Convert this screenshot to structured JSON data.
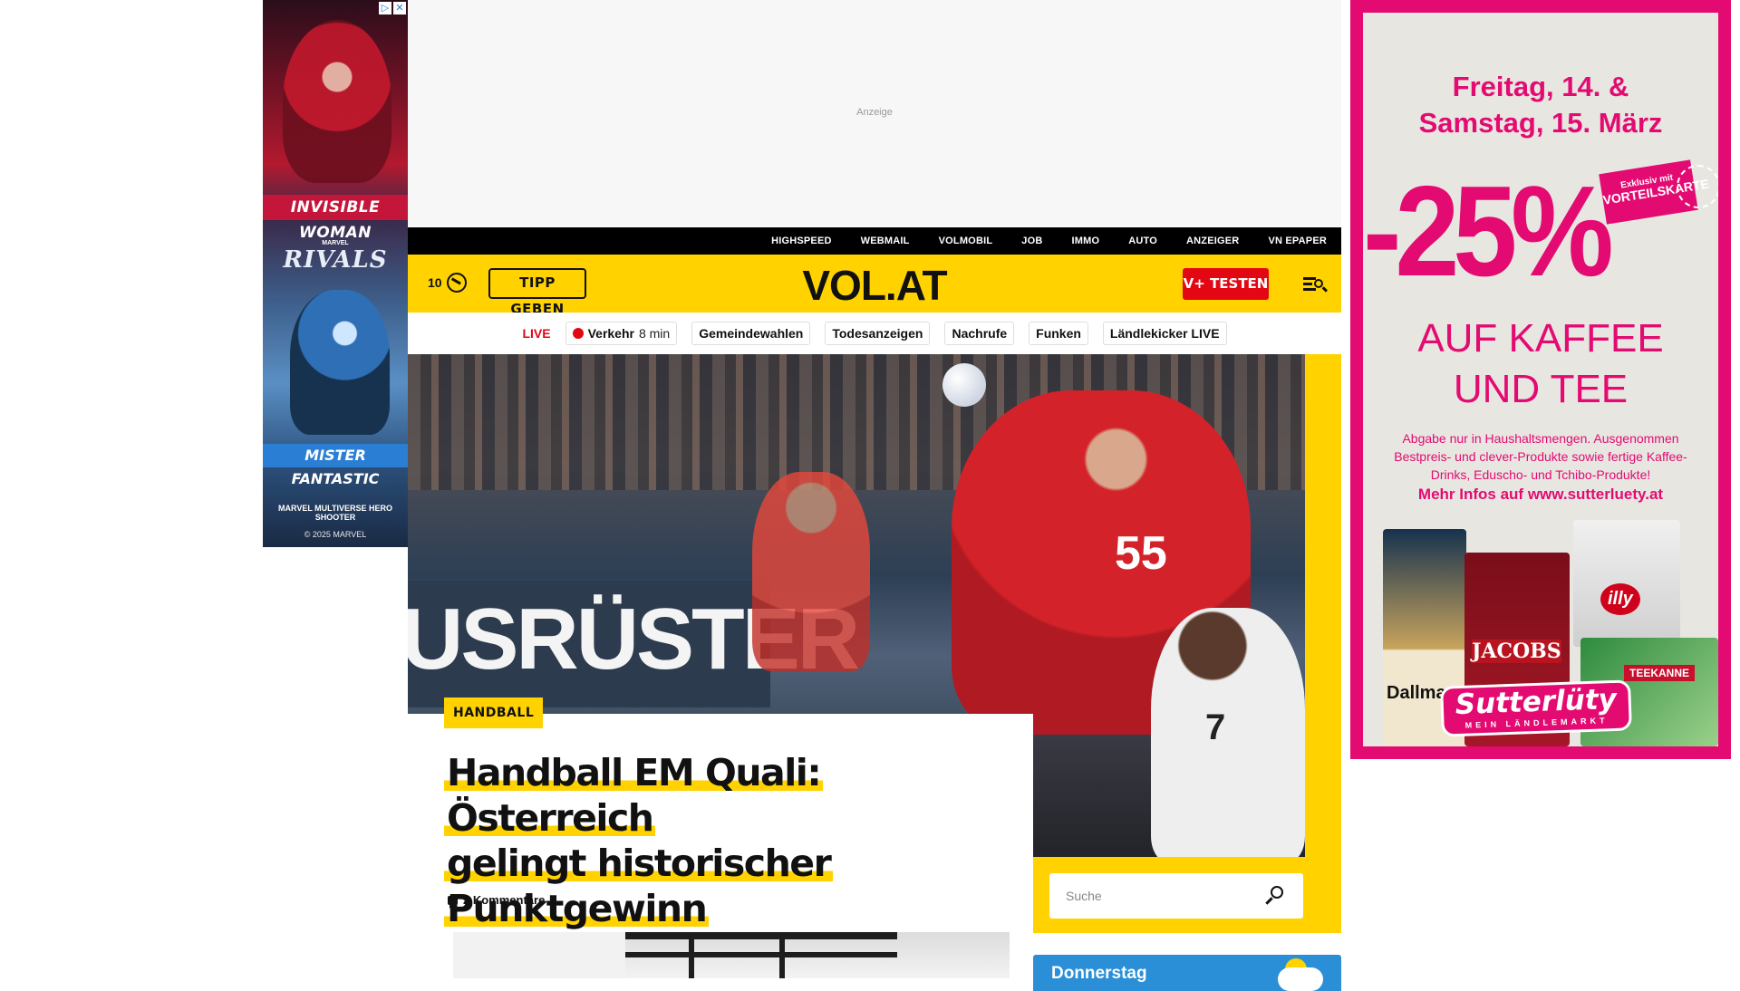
{
  "ad_left": {
    "hero1_name": "INVISIBLE WOMAN",
    "brand_small": "MARVEL",
    "brand": "RIVALS",
    "hero2_name": "MISTER FANTASTIC",
    "tagline": "MARVEL MULTIVERSE HERO SHOOTER",
    "copyright": "© 2025 MARVEL"
  },
  "ad_top": {
    "label": "Anzeige"
  },
  "service_nav": [
    "HIGHSPEED",
    "WEBMAIL",
    "VOLMOBIL",
    "JOB",
    "IMMO",
    "AUTO",
    "ANZEIGER",
    "VN EPAPER"
  ],
  "header": {
    "notif_count": "10",
    "tipp_label": "TIPP GEBEN",
    "logo": "VOL.AT",
    "vplus_label": "V+ TESTEN",
    "brand_color": "#ffd200",
    "accent_red": "#e30613"
  },
  "topics": {
    "live_label": "LIVE",
    "traffic_label": "Verkehr",
    "traffic_time": "8 min",
    "items": [
      "Gemeindewahlen",
      "Todesanzeigen",
      "Nachrufe",
      "Funken",
      "Ländlekicker LIVE"
    ]
  },
  "hero": {
    "board_text": "USRÜSTER",
    "jersey_number": "55",
    "opponent_number": "7"
  },
  "article": {
    "category": "HANDBALL",
    "headline_lines": [
      "Handball EM Quali: Österreich",
      "gelingt historischer",
      "Punktgewinn"
    ],
    "comments": "2 Kommentare"
  },
  "search": {
    "placeholder": "Suche"
  },
  "weather": {
    "day": "Donnerstag"
  },
  "ad_right": {
    "date_line1": "Freitag, 14. &",
    "date_line2": "Samstag, 15. März",
    "discount": "-25%",
    "sticker_small": "Exklusiv mit",
    "sticker_big": "VORTEILSKARTE",
    "product_line1": "AUF KAFFEE",
    "product_line2": "UND TEE",
    "fine_print": "Abgabe nur in Haushaltsmengen. Ausgenommen Bestpreis- und clever-Produkte sowie fertige Kaffee-Drinks, Eduscho- und Tchibo-Produkte!",
    "more_info": "Mehr Infos auf www.sutterluety.at",
    "pack_brands": [
      "Dallmayr",
      "JACOBS",
      "illy",
      "TEEKANNE"
    ],
    "brand": "Sutterlüty",
    "brand_sub": "MEIN LÄNDLEMARKT",
    "brand_color": "#e30b72"
  }
}
